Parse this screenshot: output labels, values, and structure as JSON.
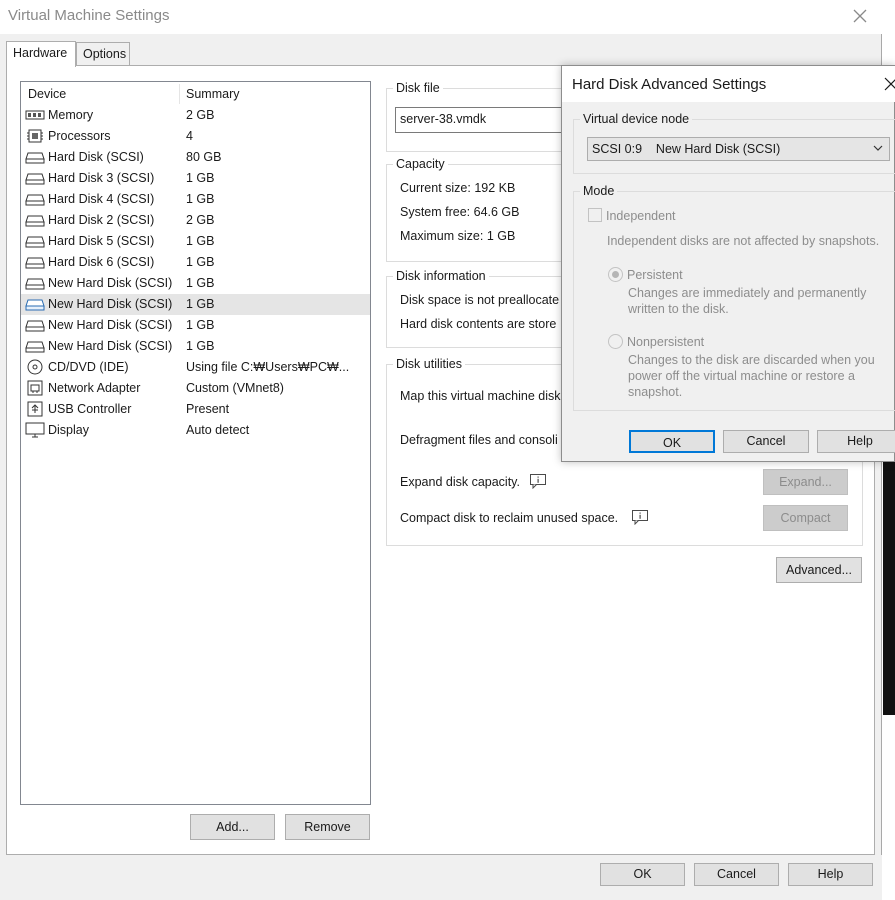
{
  "window": {
    "title": "Virtual Machine Settings",
    "tabs": [
      {
        "label": "Hardware"
      },
      {
        "label": "Options"
      }
    ]
  },
  "device_list": {
    "header_device": "Device",
    "header_summary": "Summary",
    "devices": [
      {
        "name": "Memory",
        "summary": "2 GB",
        "icon": "memory-icon"
      },
      {
        "name": "Processors",
        "summary": "4",
        "icon": "processor-icon"
      },
      {
        "name": "Hard Disk (SCSI)",
        "summary": "80 GB",
        "icon": "hard-disk-icon"
      },
      {
        "name": "Hard Disk 3 (SCSI)",
        "summary": "1 GB",
        "icon": "hard-disk-icon"
      },
      {
        "name": "Hard Disk 4 (SCSI)",
        "summary": "1 GB",
        "icon": "hard-disk-icon"
      },
      {
        "name": "Hard Disk 2 (SCSI)",
        "summary": "2 GB",
        "icon": "hard-disk-icon"
      },
      {
        "name": "Hard Disk 5 (SCSI)",
        "summary": "1 GB",
        "icon": "hard-disk-icon"
      },
      {
        "name": "Hard Disk 6 (SCSI)",
        "summary": "1 GB",
        "icon": "hard-disk-icon"
      },
      {
        "name": "New Hard Disk (SCSI)",
        "summary": "1 GB",
        "icon": "hard-disk-icon"
      },
      {
        "name": "New Hard Disk (SCSI)",
        "summary": "1 GB",
        "icon": "hard-disk-icon",
        "selected": true
      },
      {
        "name": "New Hard Disk (SCSI)",
        "summary": "1 GB",
        "icon": "hard-disk-icon"
      },
      {
        "name": "New Hard Disk (SCSI)",
        "summary": "1 GB",
        "icon": "hard-disk-icon"
      },
      {
        "name": "CD/DVD (IDE)",
        "summary": "Using file C:₩Users₩PC₩...",
        "icon": "cd-dvd-icon"
      },
      {
        "name": "Network Adapter",
        "summary": "Custom (VMnet8)",
        "icon": "network-adapter-icon"
      },
      {
        "name": "USB Controller",
        "summary": "Present",
        "icon": "usb-icon"
      },
      {
        "name": "Display",
        "summary": "Auto detect",
        "icon": "display-icon"
      }
    ],
    "add_label": "Add...",
    "remove_label": "Remove"
  },
  "disk_file": {
    "title": "Disk file",
    "value": "server-38.vmdk"
  },
  "capacity": {
    "title": "Capacity",
    "current_size": "Current size:  192 KB",
    "system_free": "System free:  64.6 GB",
    "maximum_size": "Maximum size:  1 GB"
  },
  "disk_information": {
    "title": "Disk information",
    "line1": "Disk space is not preallocate",
    "line2": "Hard disk contents are store"
  },
  "disk_utilities": {
    "title": "Disk utilities",
    "map_text": "Map this virtual machine disk",
    "defrag_text": "Defragment files and consoli",
    "expand_text": "Expand disk capacity.",
    "expand_label": "Expand...",
    "compact_text": "Compact disk to reclaim unused space.",
    "compact_label": "Compact"
  },
  "advanced_label": "Advanced...",
  "footer": {
    "ok_label": "OK",
    "cancel_label": "Cancel",
    "help_label": "Help"
  },
  "advanced_dialog": {
    "title": "Hard Disk Advanced Settings",
    "virtual_device_node_title": "Virtual device node",
    "node_value": "SCSI 0:9    New Hard Disk (SCSI)",
    "mode_title": "Mode",
    "independent_label": "Independent",
    "independent_desc": "Independent disks are not affected by snapshots.",
    "persistent_label": "Persistent",
    "persistent_desc_1": "Changes are immediately and permanently",
    "persistent_desc_2": "written to the disk.",
    "nonpersistent_label": "Nonpersistent",
    "nonpersistent_desc_1": "Changes to the disk are discarded when you",
    "nonpersistent_desc_2": "power off the virtual machine or restore a",
    "nonpersistent_desc_3": "snapshot.",
    "ok_label": "OK",
    "cancel_label": "Cancel",
    "help_label": "Help"
  }
}
